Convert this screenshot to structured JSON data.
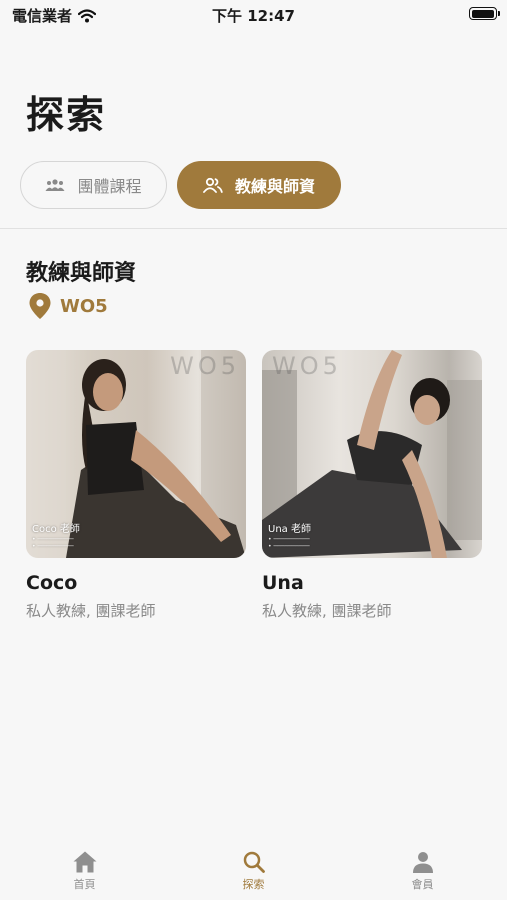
{
  "status_bar": {
    "carrier": "電信業者",
    "time": "下午 12:47"
  },
  "page_title": "探索",
  "tabs": [
    {
      "label": "團體課程",
      "icon": "group-icon",
      "active": false
    },
    {
      "label": "教練與師資",
      "icon": "users-icon",
      "active": true
    }
  ],
  "section": {
    "title": "教練與師資",
    "location": "WO5"
  },
  "coaches": [
    {
      "name": "Coco",
      "role": "私人教練, 團課老師",
      "photo_caption": "Coco 老師",
      "watermark": "WO5"
    },
    {
      "name": "Una",
      "role": "私人教練, 團課老師",
      "photo_caption": "Una 老師",
      "watermark": "WO5"
    }
  ],
  "tab_bar": [
    {
      "label": "首頁",
      "icon": "home-icon",
      "active": false
    },
    {
      "label": "探索",
      "icon": "search-icon",
      "active": true
    },
    {
      "label": "會員",
      "icon": "person-icon",
      "active": false
    }
  ],
  "colors": {
    "accent": "#a07a3c",
    "background": "#f7f7f7",
    "muted_text": "#8a8a8a"
  }
}
